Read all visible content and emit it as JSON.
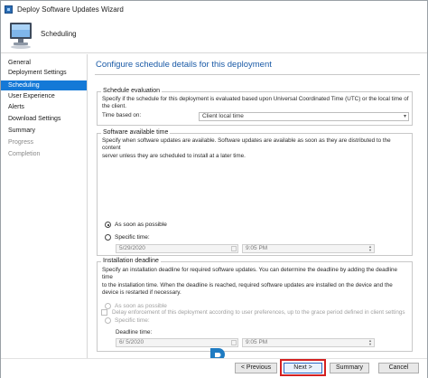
{
  "window": {
    "title": "Deploy Software Updates Wizard"
  },
  "banner": {
    "title": "Scheduling",
    "icon": "computer-monitor-icon"
  },
  "nav": {
    "items": [
      {
        "label": "General",
        "state": "normal"
      },
      {
        "label": "Deployment Settings",
        "state": "normal"
      },
      {
        "label": "Scheduling",
        "state": "active"
      },
      {
        "label": "User Experience",
        "state": "normal"
      },
      {
        "label": "Alerts",
        "state": "normal"
      },
      {
        "label": "Download Settings",
        "state": "normal"
      },
      {
        "label": "Summary",
        "state": "normal"
      },
      {
        "label": "Progress",
        "state": "disabled"
      },
      {
        "label": "Completion",
        "state": "disabled"
      }
    ]
  },
  "content": {
    "title": "Configure schedule details for this deployment",
    "evaluation": {
      "legend": "Schedule evaluation",
      "description_line1": "Specify if the schedule for this deployment is evaluated based upon Universal Coordinated Time (UTC) or the local time of",
      "description_line2": "the client.",
      "time_based_label": "Time based on:",
      "time_based_value": "Client local time"
    },
    "available": {
      "legend": "Software available time",
      "description_line1": "Specify when software updates are available. Software updates are available as soon as they are distributed to the content",
      "description_line2": "server unless they are scheduled to install at a later time.",
      "asap_label": "As soon as possible",
      "specific_label": "Specific time:",
      "date_value": "5/29/2020",
      "time_value": "9:05 PM"
    },
    "deadline": {
      "legend": "Installation deadline",
      "description_line1": "Specify an installation deadline for required software updates. You can determine the deadline by adding the deadline time",
      "description_line2": "to the installation time. When the deadline is reached, required software updates are installed on the device and the",
      "description_line3": "device is restarted if necessary.",
      "asap_label": "As soon as possible",
      "specific_label": "Specific time:",
      "deadline_time_label": "Deadline time:",
      "date_value": "6/  5/2020",
      "time_value": "9:05 PM"
    },
    "delay_checkbox_label": "Delay enforcement of this deployment according to user preferences, up to the grace period defined in client settings"
  },
  "footer": {
    "previous_label": "< Previous",
    "next_label": "Next >",
    "summary_label": "Summary",
    "cancel_label": "Cancel"
  },
  "colors": {
    "accent": "#1479d7",
    "title_blue": "#1a5aa6",
    "highlight_red": "#d42020"
  }
}
